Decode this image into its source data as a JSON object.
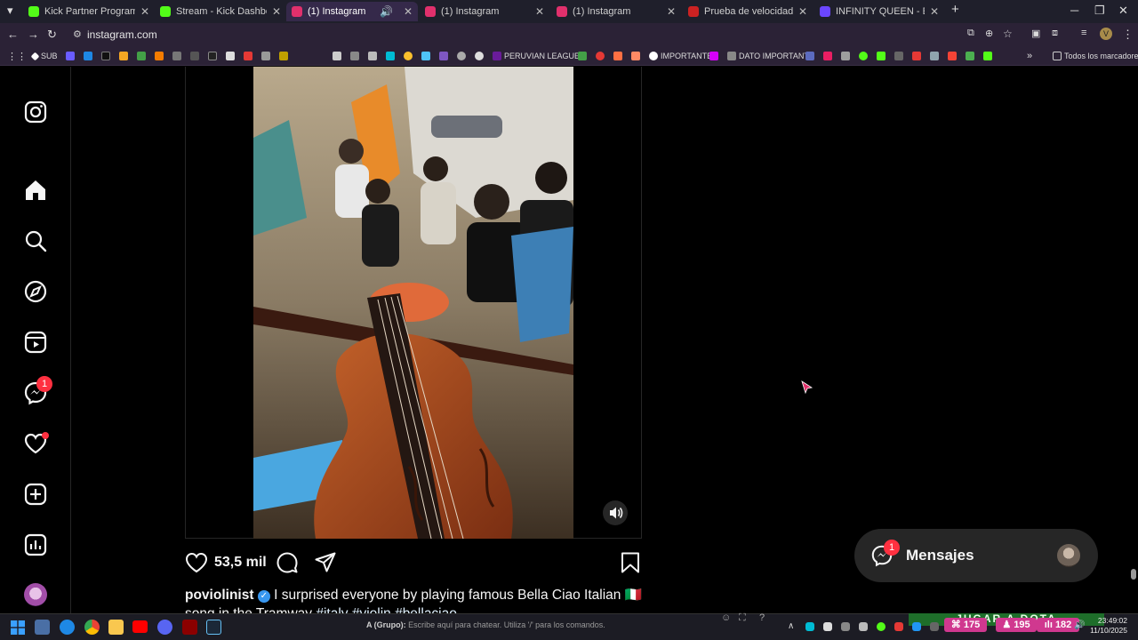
{
  "browser": {
    "tabs": [
      {
        "title": "Kick Partner Program - Kick Da",
        "favicon_color": "#53fc18",
        "active": false
      },
      {
        "title": "Stream - Kick Dashboard",
        "favicon_color": "#53fc18",
        "active": false
      },
      {
        "title": "(1) Instagram",
        "favicon_color": "#e1306c",
        "active": true
      },
      {
        "title": "(1) Instagram",
        "favicon_color": "#e1306c",
        "active": false
      },
      {
        "title": "(1) Instagram",
        "favicon_color": "#e1306c",
        "active": false
      },
      {
        "title": "Prueba de velocidad de Interne",
        "favicon_color": "#cc2222",
        "active": false
      },
      {
        "title": "INFINITY QUEEN - ESPORTS FE",
        "favicon_color": "#6b46ff",
        "active": false
      }
    ],
    "url": "instagram.com",
    "profile_initial": "V",
    "bookmarks": {
      "sub": "SUB",
      "peruvian": "PERUVIAN LEAGUE...",
      "importante": "IMPORTANTE",
      "dato": "DATO IMPORTANTE",
      "all": "Todos los marcadores"
    }
  },
  "instagram": {
    "notifications_badge": "1",
    "post": {
      "likes": "53,5 mil",
      "username": "poviolinist",
      "caption": "I surprised everyone by playing famous Bella Ciao Italian 🇮🇹",
      "caption_line2": "song in the Tramway",
      "hashtags": "#italy #violin #bellaciao"
    },
    "messages": {
      "label": "Mensajes",
      "badge": "1"
    }
  },
  "taskbar": {
    "chat_prefix": "A (Grupo):",
    "chat_placeholder": "Escribe aquí para chatear. Utiliza '/' para los comandos.",
    "promo": "JUGAR A DOTA",
    "stat1": "175",
    "stat2": "195",
    "stat3": "182",
    "time": "23:49:02",
    "date": "11/10/2025"
  },
  "colors": {
    "brand_pink": "#d0388f",
    "notification_red": "#ff3040",
    "verified_blue": "#3897f0"
  }
}
